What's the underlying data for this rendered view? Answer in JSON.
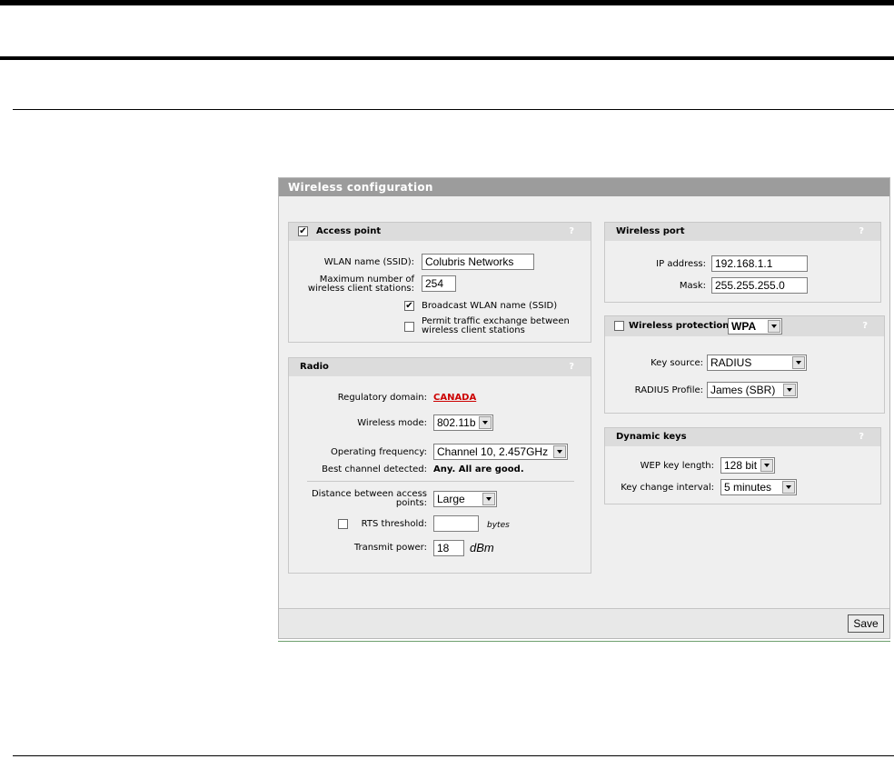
{
  "panel": {
    "title": "Wireless configuration",
    "save_label": "Save"
  },
  "access_point": {
    "title": "Access point",
    "checked_mark": "✔",
    "help": "?",
    "ssid_label": "WLAN name (SSID):",
    "ssid_value": "Colubris Networks",
    "max_label_1": "Maximum number of",
    "max_label_2": "wireless client stations:",
    "max_value": "254",
    "broadcast_label": "Broadcast WLAN name (SSID)",
    "permit_label_1": "Permit traffic exchange between",
    "permit_label_2": "wireless client stations"
  },
  "radio": {
    "title": "Radio",
    "help": "?",
    "domain_label": "Regulatory domain:",
    "domain_value": "CANADA",
    "mode_label": "Wireless mode:",
    "mode_value": "802.11b",
    "freq_label": "Operating frequency:",
    "freq_value": "Channel 10, 2.457GHz",
    "best_label": "Best channel detected:",
    "best_value": "Any. All are good.",
    "dist_label_1": "Distance between access",
    "dist_label_2": "points:",
    "dist_value": "Large",
    "rts_label": "RTS threshold:",
    "rts_value": "",
    "rts_unit": "bytes",
    "power_label": "Transmit power:",
    "power_value": "18",
    "power_unit": "dBm"
  },
  "wireless_port": {
    "title": "Wireless port",
    "help": "?",
    "ip_label": "IP address:",
    "ip_value": "192.168.1.1",
    "mask_label": "Mask:",
    "mask_value": "255.255.255.0"
  },
  "wireless_protection": {
    "title": "Wireless protection",
    "help": "?",
    "mode_value": "WPA",
    "key_source_label": "Key source:",
    "key_source_value": "RADIUS",
    "profile_label": "RADIUS Profile:",
    "profile_value": "James (SBR)"
  },
  "dynamic_keys": {
    "title": "Dynamic keys",
    "help": "?",
    "wep_label": "WEP key length:",
    "wep_value": "128 bit",
    "interval_label": "Key change interval:",
    "interval_value": "5 minutes"
  }
}
